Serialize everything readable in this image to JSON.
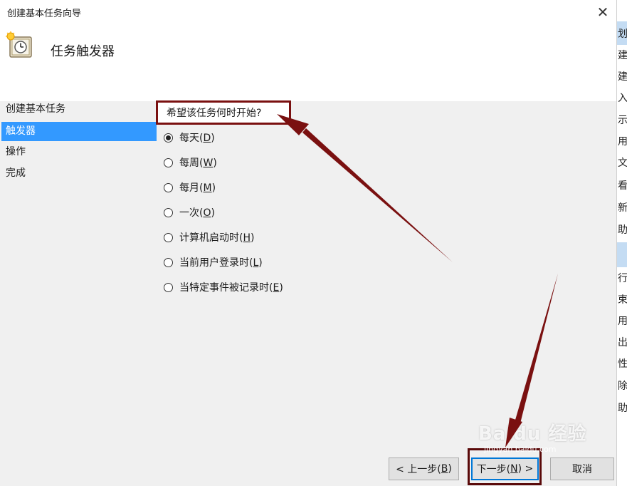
{
  "dialog": {
    "title": "创建基本任务向导",
    "close_label": "✕",
    "header_title": "任务触发器"
  },
  "nav": {
    "items": [
      {
        "label": "创建基本任务",
        "active": false
      },
      {
        "label": "触发器",
        "active": true
      },
      {
        "label": "操作",
        "active": false
      },
      {
        "label": "完成",
        "active": false
      }
    ]
  },
  "main": {
    "question": "希望该任务何时开始?",
    "options": [
      {
        "pre": "每天(",
        "key": "D",
        "post": ")",
        "selected": true
      },
      {
        "pre": "每周(",
        "key": "W",
        "post": ")",
        "selected": false
      },
      {
        "pre": "每月(",
        "key": "M",
        "post": ")",
        "selected": false
      },
      {
        "pre": "一次(",
        "key": "O",
        "post": ")",
        "selected": false
      },
      {
        "pre": "计算机启动时(",
        "key": "H",
        "post": ")",
        "selected": false
      },
      {
        "pre": "当前用户登录时(",
        "key": "L",
        "post": ")",
        "selected": false
      },
      {
        "pre": "当特定事件被记录时(",
        "key": "E",
        "post": ")",
        "selected": false
      }
    ]
  },
  "buttons": {
    "prev": {
      "pre": "< 上一步(",
      "key": "B",
      "post": ")"
    },
    "next": {
      "pre": "下一步(",
      "key": "N",
      "post": ") >"
    },
    "cancel": "取消"
  },
  "background_window": {
    "items": [
      "划",
      "建",
      "建",
      "入",
      "示",
      "用",
      "文",
      "看",
      "新",
      "助",
      "行",
      "束",
      "用",
      "出",
      "性",
      "除",
      "助"
    ]
  },
  "watermark": {
    "text": "Baidu 经验",
    "sub": "jingyan.baidu.com"
  },
  "colors": {
    "accent": "#3399ff",
    "annotation": "#7a1010",
    "focus_border": "#0078d7"
  },
  "icons": {
    "header": "scheduled-task-clock-icon",
    "close": "close-icon"
  }
}
